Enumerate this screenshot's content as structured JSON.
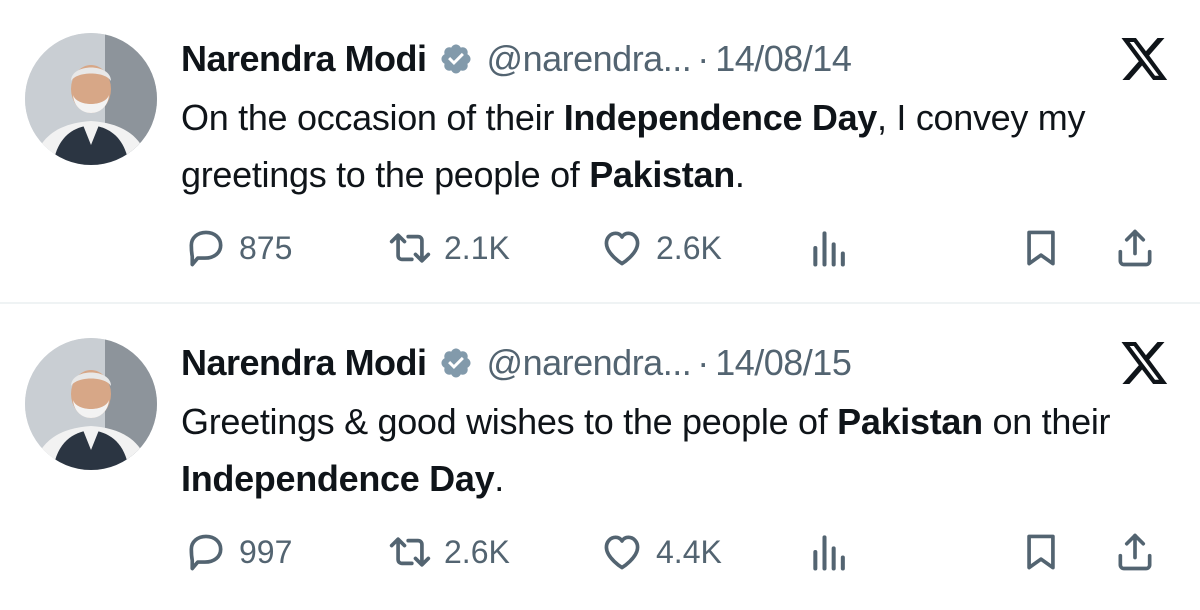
{
  "tweets": [
    {
      "author": "Narendra Modi",
      "handle": "@narendra...",
      "separator": "·",
      "date": "14/08/14",
      "text_parts": [
        {
          "t": "On the occasion of their ",
          "b": false
        },
        {
          "t": "Independence Day",
          "b": true
        },
        {
          "t": ", I convey my greetings to the people of ",
          "b": false
        },
        {
          "t": "Pakistan",
          "b": true
        },
        {
          "t": ".",
          "b": false
        }
      ],
      "replies": "875",
      "retweets": "2.1K",
      "likes": "2.6K"
    },
    {
      "author": "Narendra Modi",
      "handle": "@narendra...",
      "separator": "·",
      "date": "14/08/15",
      "text_parts": [
        {
          "t": "Greetings & good wishes to the people of ",
          "b": false
        },
        {
          "t": "Pakistan",
          "b": true
        },
        {
          "t": " on their ",
          "b": false
        },
        {
          "t": "Independence Day",
          "b": true
        },
        {
          "t": ".",
          "b": false
        }
      ],
      "replies": "997",
      "retweets": "2.6K",
      "likes": "4.4K"
    }
  ],
  "icons": {
    "verified_badge": "verified-badge-icon",
    "brand": "x-logo-icon",
    "reply": "reply-icon",
    "retweet": "retweet-icon",
    "like": "heart-icon",
    "views": "views-icon",
    "bookmark": "bookmark-icon",
    "share": "share-icon"
  },
  "colors": {
    "text": "#0f1419",
    "secondary": "#536471",
    "divider": "#eff3f4",
    "badge": "#829aab"
  }
}
